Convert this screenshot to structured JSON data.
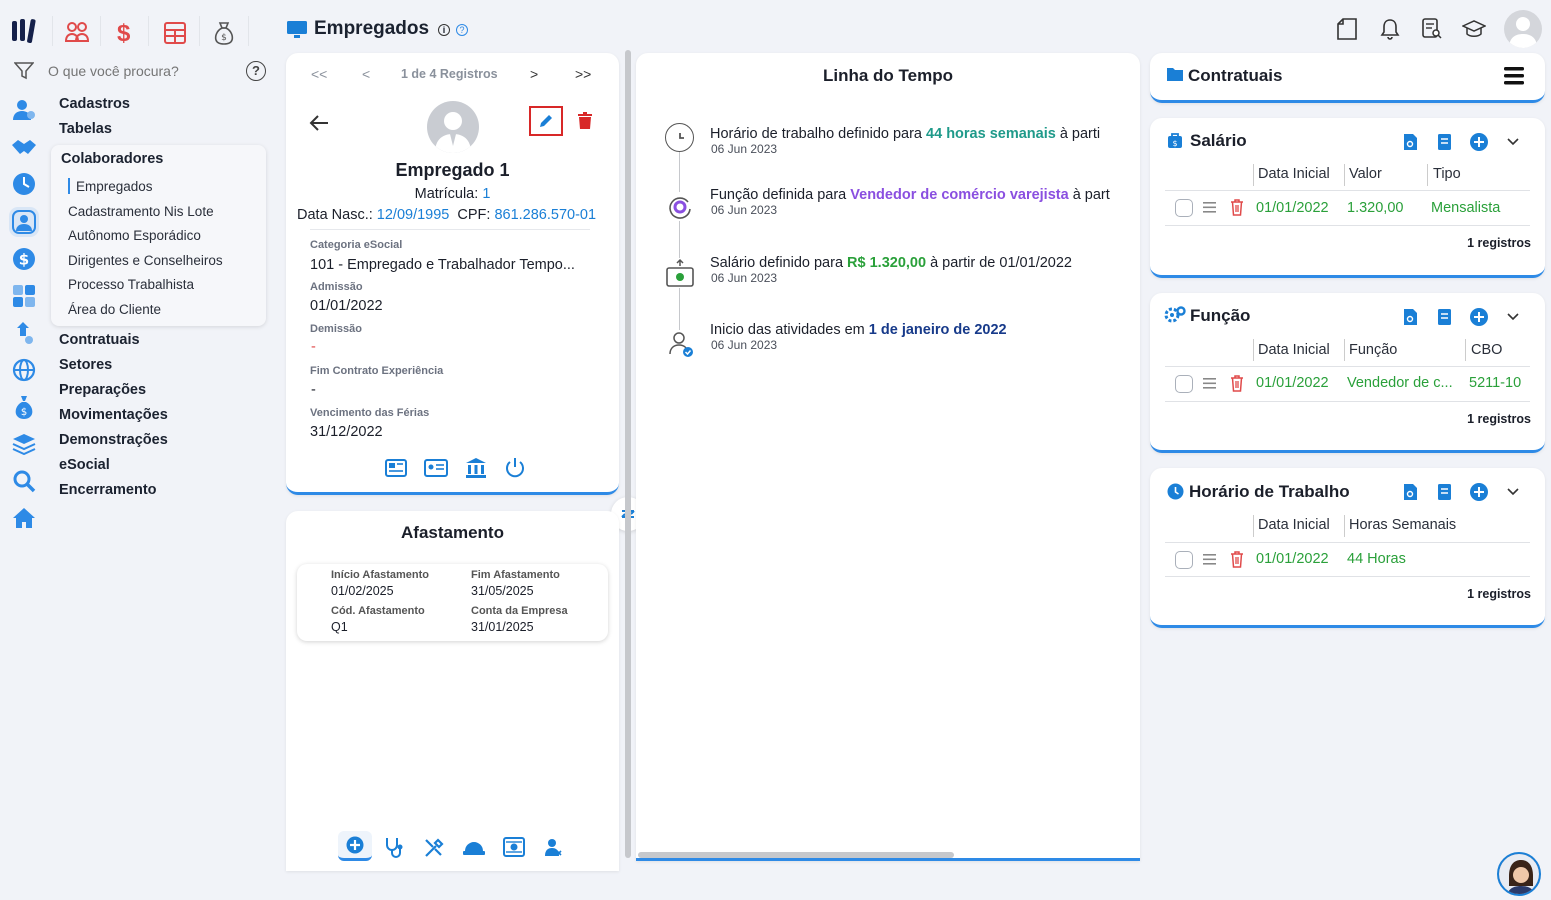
{
  "header": {
    "page_title": "Empregados",
    "top_tabs": [
      "people-icon",
      "dollar-icon",
      "calculator-icon",
      "money-bag-icon"
    ]
  },
  "search": {
    "placeholder": "O que você procura?"
  },
  "menu": {
    "cadastros": "Cadastros",
    "tabelas": "Tabelas",
    "colaboradores": "Colaboradores",
    "sub": [
      "Empregados",
      "Cadastramento Nis Lote",
      "Autônomo Esporádico",
      "Dirigentes e Conselheiros",
      "Processo Trabalhista",
      "Área do Cliente"
    ],
    "rest": [
      "Contratuais",
      "Setores",
      "Preparações",
      "Movimentações",
      "Demonstrações",
      "eSocial",
      "Encerramento"
    ]
  },
  "employee": {
    "pager": "1 de 4 Registros",
    "name": "Empregado 1",
    "matricula_label": "Matrícula:",
    "matricula": "1",
    "nasc_label": "Data Nasc.:",
    "nasc": "12/09/1995",
    "cpf_label": "CPF:",
    "cpf": "861.286.570-01",
    "cat_label": "Categoria eSocial",
    "cat": "101 - Empregado e Trabalhador Tempo...",
    "adm_label": "Admissão",
    "adm": "01/01/2022",
    "dem_label": "Demissão",
    "dem": "-",
    "fim_label": "Fim Contrato Experiência",
    "fim": "-",
    "venc_label": "Vencimento das Férias",
    "venc": "31/12/2022"
  },
  "afastamento": {
    "title": "Afastamento",
    "inicio_label": "Início Afastamento",
    "inicio": "01/02/2025",
    "fim_label": "Fim Afastamento",
    "fim": "31/05/2025",
    "cod_label": "Cód. Afastamento",
    "cod": "Q1",
    "conta_label": "Conta da Empresa",
    "conta": "31/01/2025"
  },
  "timeline": {
    "title": "Linha do Tempo",
    "items": [
      {
        "pre": "Horário de trabalho definido para ",
        "hl": "44 horas semanais",
        "post": " à parti",
        "date": "06 Jun 2023",
        "color": "#1f9a8a"
      },
      {
        "pre": "Função definida para ",
        "hl": "Vendedor de comércio varejista",
        "post": " à part",
        "date": "06 Jun 2023",
        "color": "#8a4fe0"
      },
      {
        "pre": "Salário definido para ",
        "hl": "R$ 1.320,00",
        "post": " à partir de 01/01/2022",
        "date": "06 Jun 2023",
        "color": "#2aa03a"
      },
      {
        "pre": "Inicio das atividades em ",
        "hl": "1 de janeiro de 2022",
        "post": "",
        "date": "06 Jun 2023",
        "color": "#173a8a"
      }
    ]
  },
  "contratuais": {
    "title": "Contratuais",
    "salario": {
      "title": "Salário",
      "headers": [
        "Data Inicial",
        "Valor",
        "Tipo"
      ],
      "row": [
        "01/01/2022",
        "1.320,00",
        "Mensalista"
      ],
      "count": "1 registros"
    },
    "funcao": {
      "title": "Função",
      "headers": [
        "Data Inicial",
        "Função",
        "CBO"
      ],
      "row": [
        "01/01/2022",
        "Vendedor de c...",
        "5211-10"
      ],
      "count": "1 registros"
    },
    "horario": {
      "title": "Horário de Trabalho",
      "headers": [
        "Data Inicial",
        "Horas Semanais"
      ],
      "row": [
        "01/01/2022",
        "44 Horas"
      ],
      "count": "1 registros"
    }
  }
}
